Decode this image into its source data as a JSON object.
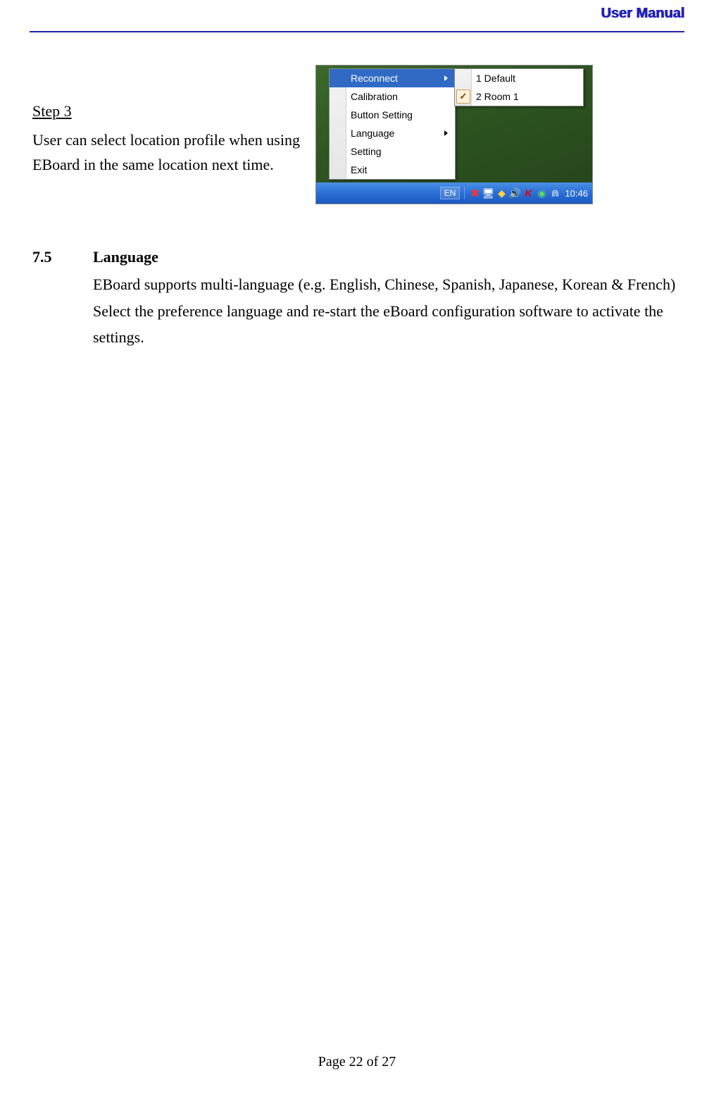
{
  "header": {
    "title": "User Manual"
  },
  "step": {
    "heading": "Step 3",
    "body": "User can select location profile when using EBoard in the same location next time."
  },
  "screenshot": {
    "menu": {
      "items": [
        {
          "label": "Reconnect",
          "hasSubmenu": true,
          "highlighted": true
        },
        {
          "label": "Calibration",
          "hasSubmenu": false,
          "highlighted": false
        },
        {
          "label": "Button Setting",
          "hasSubmenu": false,
          "highlighted": false
        },
        {
          "label": "Language",
          "hasSubmenu": true,
          "highlighted": false
        },
        {
          "label": "Setting",
          "hasSubmenu": false,
          "highlighted": false
        },
        {
          "label": "Exit",
          "hasSubmenu": false,
          "highlighted": false
        }
      ],
      "submenu": [
        {
          "label": "1 Default",
          "checked": false
        },
        {
          "label": "2 Room 1",
          "checked": true
        }
      ]
    },
    "taskbar": {
      "lang": "EN",
      "time": "10:46"
    }
  },
  "section75": {
    "number": "7.5",
    "title": "Language",
    "para1": "EBoard supports multi-language (e.g. English, Chinese, Spanish, Japanese, Korean & French)",
    "para2": "Select the preference language and re-start the eBoard configuration software to activate the settings."
  },
  "footer": {
    "text": "Page 22 of 27"
  }
}
